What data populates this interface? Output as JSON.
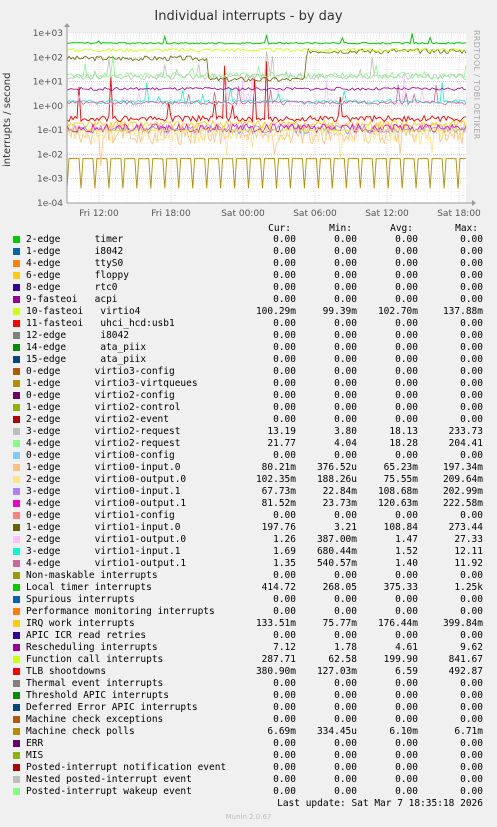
{
  "chart_data": {
    "type": "line",
    "title": "Individual interrupts - by day",
    "ylabel": "interrupts / second",
    "yscale": "log",
    "ylim": [
      0.0001,
      1000
    ],
    "y_ticks": [
      "1e-04",
      "1e-03",
      "1e-02",
      "1e-01",
      "1e+00",
      "1e+01",
      "1e+02",
      "1e+03"
    ],
    "x_ticks": [
      "Fri 12:00",
      "Fri 18:00",
      "Sat 00:00",
      "Sat 06:00",
      "Sat 12:00",
      "Sat 18:00"
    ],
    "grid": true,
    "vertical_credit": "RRDTOOL / TOBI OETIKER"
  },
  "legend_header": {
    "cur": "Cur:",
    "min": "Min:",
    "avg": "Avg:",
    "max": "Max:"
  },
  "legend": [
    {
      "label": "2-edge      timer",
      "color": "#00cc00",
      "cur": "0.00",
      "min": "0.00",
      "avg": "0.00",
      "max": "0.00"
    },
    {
      "label": "1-edge      i8042",
      "color": "#0066b3",
      "cur": "0.00",
      "min": "0.00",
      "avg": "0.00",
      "max": "0.00"
    },
    {
      "label": "4-edge      ttyS0",
      "color": "#ff8000",
      "cur": "0.00",
      "min": "0.00",
      "avg": "0.00",
      "max": "0.00"
    },
    {
      "label": "6-edge      floppy",
      "color": "#ffcc00",
      "cur": "0.00",
      "min": "0.00",
      "avg": "0.00",
      "max": "0.00"
    },
    {
      "label": "8-edge      rtc0",
      "color": "#330099",
      "cur": "0.00",
      "min": "0.00",
      "avg": "0.00",
      "max": "0.00"
    },
    {
      "label": "9-fasteoi   acpi",
      "color": "#990099",
      "cur": "0.00",
      "min": "0.00",
      "avg": "0.00",
      "max": "0.00"
    },
    {
      "label": "10-fasteoi   virtio4",
      "color": "#ccff00",
      "cur": "100.29m",
      "min": "99.39m",
      "avg": "102.70m",
      "max": "137.88m"
    },
    {
      "label": "11-fasteoi   uhci_hcd:usb1",
      "color": "#ff0000",
      "cur": "0.00",
      "min": "0.00",
      "avg": "0.00",
      "max": "0.00"
    },
    {
      "label": "12-edge      i8042",
      "color": "#808080",
      "cur": "0.00",
      "min": "0.00",
      "avg": "0.00",
      "max": "0.00"
    },
    {
      "label": "14-edge      ata_piix",
      "color": "#008f00",
      "cur": "0.00",
      "min": "0.00",
      "avg": "0.00",
      "max": "0.00"
    },
    {
      "label": "15-edge      ata_piix",
      "color": "#00487d",
      "cur": "0.00",
      "min": "0.00",
      "avg": "0.00",
      "max": "0.00"
    },
    {
      "label": "0-edge      virtio3-config",
      "color": "#b35a00",
      "cur": "0.00",
      "min": "0.00",
      "avg": "0.00",
      "max": "0.00"
    },
    {
      "label": "1-edge      virtio3-virtqueues",
      "color": "#b38f00",
      "cur": "0.00",
      "min": "0.00",
      "avg": "0.00",
      "max": "0.00"
    },
    {
      "label": "0-edge      virtio2-config",
      "color": "#6b006b",
      "cur": "0.00",
      "min": "0.00",
      "avg": "0.00",
      "max": "0.00"
    },
    {
      "label": "1-edge      virtio2-control",
      "color": "#8fb300",
      "cur": "0.00",
      "min": "0.00",
      "avg": "0.00",
      "max": "0.00"
    },
    {
      "label": "2-edge      virtio2-event",
      "color": "#b30000",
      "cur": "0.00",
      "min": "0.00",
      "avg": "0.00",
      "max": "0.00"
    },
    {
      "label": "3-edge      virtio2-request",
      "color": "#bebebe",
      "cur": "13.19",
      "min": "3.80",
      "avg": "18.13",
      "max": "233.73"
    },
    {
      "label": "4-edge      virtio2-request",
      "color": "#80ff80",
      "cur": "21.77",
      "min": "4.04",
      "avg": "18.28",
      "max": "204.41"
    },
    {
      "label": "0-edge      virtio0-config",
      "color": "#80c9ff",
      "cur": "0.00",
      "min": "0.00",
      "avg": "0.00",
      "max": "0.00"
    },
    {
      "label": "1-edge      virtio0-input.0",
      "color": "#ffc080",
      "cur": "80.21m",
      "min": "376.52u",
      "avg": "65.23m",
      "max": "197.34m"
    },
    {
      "label": "2-edge      virtio0-output.0",
      "color": "#ffe680",
      "cur": "102.35m",
      "min": "188.26u",
      "avg": "75.55m",
      "max": "209.64m"
    },
    {
      "label": "3-edge      virtio0-input.1",
      "color": "#aa80ff",
      "cur": "67.73m",
      "min": "22.84m",
      "avg": "108.68m",
      "max": "202.99m"
    },
    {
      "label": "4-edge      virtio0-output.1",
      "color": "#ee00cc",
      "cur": "81.52m",
      "min": "23.73m",
      "avg": "120.63m",
      "max": "222.58m"
    },
    {
      "label": "0-edge      virtio1-config",
      "color": "#ff8080",
      "cur": "0.00",
      "min": "0.00",
      "avg": "0.00",
      "max": "0.00"
    },
    {
      "label": "1-edge      virtio1-input.0",
      "color": "#666600",
      "cur": "197.76",
      "min": "3.21",
      "avg": "108.84",
      "max": "273.44"
    },
    {
      "label": "2-edge      virtio1-output.0",
      "color": "#ffbfff",
      "cur": "1.26",
      "min": "387.00m",
      "avg": "1.47",
      "max": "27.33"
    },
    {
      "label": "3-edge      virtio1-input.1",
      "color": "#00ffcc",
      "cur": "1.69",
      "min": "680.44m",
      "avg": "1.52",
      "max": "12.11"
    },
    {
      "label": "4-edge      virtio1-output.1",
      "color": "#cc6699",
      "cur": "1.35",
      "min": "540.57m",
      "avg": "1.40",
      "max": "11.92"
    },
    {
      "label": "Non-maskable interrupts",
      "color": "#999900",
      "cur": "0.00",
      "min": "0.00",
      "avg": "0.00",
      "max": "0.00"
    },
    {
      "label": "Local timer interrupts",
      "color": "#00cc00",
      "cur": "414.72",
      "min": "268.05",
      "avg": "375.33",
      "max": "1.25k"
    },
    {
      "label": "Spurious interrupts",
      "color": "#0066b3",
      "cur": "0.00",
      "min": "0.00",
      "avg": "0.00",
      "max": "0.00"
    },
    {
      "label": "Performance monitoring interrupts",
      "color": "#ff8000",
      "cur": "0.00",
      "min": "0.00",
      "avg": "0.00",
      "max": "0.00"
    },
    {
      "label": "IRQ work interrupts",
      "color": "#ffcc00",
      "cur": "133.51m",
      "min": "75.77m",
      "avg": "176.44m",
      "max": "399.84m"
    },
    {
      "label": "APIC ICR read retries",
      "color": "#330099",
      "cur": "0.00",
      "min": "0.00",
      "avg": "0.00",
      "max": "0.00"
    },
    {
      "label": "Rescheduling interrupts",
      "color": "#990099",
      "cur": "7.12",
      "min": "1.78",
      "avg": "4.61",
      "max": "9.62"
    },
    {
      "label": "Function call interrupts",
      "color": "#ccff00",
      "cur": "287.71",
      "min": "62.58",
      "avg": "199.90",
      "max": "841.67"
    },
    {
      "label": "TLB shootdowns",
      "color": "#ff0000",
      "cur": "380.90m",
      "min": "127.03m",
      "avg": "6.59",
      "max": "492.87"
    },
    {
      "label": "Thermal event interrupts",
      "color": "#808080",
      "cur": "0.00",
      "min": "0.00",
      "avg": "0.00",
      "max": "0.00"
    },
    {
      "label": "Threshold APIC interrupts",
      "color": "#008f00",
      "cur": "0.00",
      "min": "0.00",
      "avg": "0.00",
      "max": "0.00"
    },
    {
      "label": "Deferred Error APIC interrupts",
      "color": "#00487d",
      "cur": "0.00",
      "min": "0.00",
      "avg": "0.00",
      "max": "0.00"
    },
    {
      "label": "Machine check exceptions",
      "color": "#b35a00",
      "cur": "0.00",
      "min": "0.00",
      "avg": "0.00",
      "max": "0.00"
    },
    {
      "label": "Machine check polls",
      "color": "#b38f00",
      "cur": "6.69m",
      "min": "334.45u",
      "avg": "6.10m",
      "max": "6.71m"
    },
    {
      "label": "ERR",
      "color": "#6b006b",
      "cur": "0.00",
      "min": "0.00",
      "avg": "0.00",
      "max": "0.00"
    },
    {
      "label": "MIS",
      "color": "#8fb300",
      "cur": "0.00",
      "min": "0.00",
      "avg": "0.00",
      "max": "0.00"
    },
    {
      "label": "Posted-interrupt notification event",
      "color": "#b30000",
      "cur": "0.00",
      "min": "0.00",
      "avg": "0.00",
      "max": "0.00"
    },
    {
      "label": "Nested posted-interrupt event",
      "color": "#bebebe",
      "cur": "0.00",
      "min": "0.00",
      "avg": "0.00",
      "max": "0.00"
    },
    {
      "label": "Posted-interrupt wakeup event",
      "color": "#80ff80",
      "cur": "0.00",
      "min": "0.00",
      "avg": "0.00",
      "max": "0.00"
    }
  ],
  "last_update": "Last update: Sat Mar  7 18:35:18 2026",
  "footer": "Munin 2.0.67"
}
